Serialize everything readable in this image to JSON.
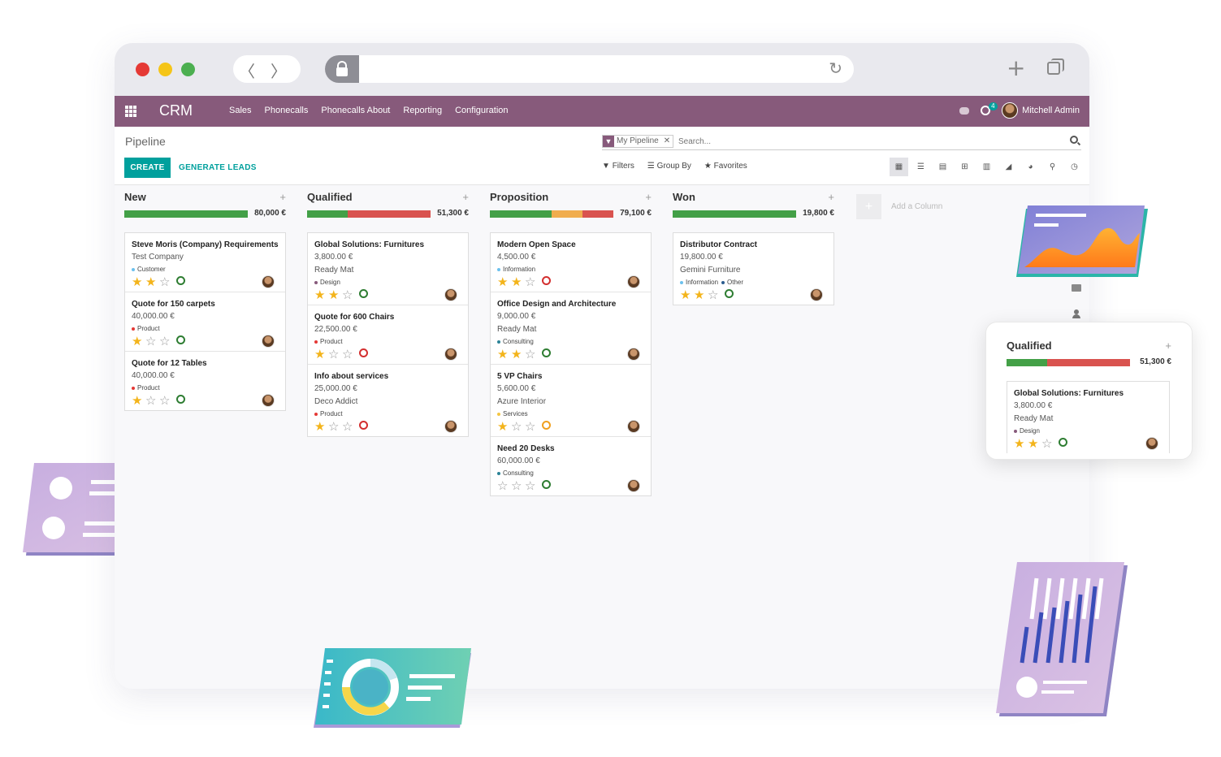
{
  "browser": {
    "back_glyph": "〈",
    "forward_glyph": "〉",
    "reload_glyph": "↻",
    "new_tab_glyph": "+",
    "dots": [
      "#e53935",
      "#f5c518",
      "#4caf50"
    ]
  },
  "topbar": {
    "brand": "CRM",
    "menu": [
      "Sales",
      "Phonecalls",
      "Phonecalls About",
      "Reporting",
      "Configuration"
    ],
    "activity_count": "4",
    "user_name": "Mitchell Admin",
    "color": "#875a7b"
  },
  "control_panel": {
    "breadcrumb": "Pipeline",
    "create_label": "CREATE",
    "generate_label": "GENERATE LEADS",
    "facet_label": "My Pipeline",
    "facet_remove": "✕",
    "search_placeholder": "Search...",
    "filters_label": "Filters",
    "group_by_label": "Group By",
    "favorites_label": "Favorites",
    "views": [
      "kanban-icon",
      "list-icon",
      "calendar-icon",
      "pivot-icon",
      "graph-icon",
      "cohort-icon",
      "dashboard-icon",
      "map-icon",
      "activity-icon"
    ]
  },
  "kanban": {
    "add_column_label": "Add a Column",
    "columns": [
      {
        "name": "New",
        "total": "80,000 €",
        "progress": [
          {
            "color": "#43a047",
            "frac": 1.0
          }
        ],
        "cards": [
          {
            "title": "Steve Moris (Company) Requirements",
            "amount": "",
            "company": "Test Company",
            "tags": [
              {
                "label": "Customer",
                "color": "#6cc1ed"
              }
            ],
            "stars": 2,
            "clock": "#2e7d32"
          },
          {
            "title": "Quote for 150 carpets",
            "amount": "40,000.00 €",
            "company": "",
            "tags": [
              {
                "label": "Product",
                "color": "#e53935"
              }
            ],
            "stars": 1,
            "clock": "#2e7d32"
          },
          {
            "title": "Quote for 12 Tables",
            "amount": "40,000.00 €",
            "company": "",
            "tags": [
              {
                "label": "Product",
                "color": "#e53935"
              }
            ],
            "stars": 1,
            "clock": "#2e7d32"
          }
        ]
      },
      {
        "name": "Qualified",
        "total": "51,300 €",
        "progress": [
          {
            "color": "#43a047",
            "frac": 0.33
          },
          {
            "color": "#d9534f",
            "frac": 0.67
          }
        ],
        "cards": [
          {
            "title": "Global Solutions: Furnitures",
            "amount": "3,800.00 €",
            "company": "Ready Mat",
            "tags": [
              {
                "label": "Design",
                "color": "#875a7b"
              }
            ],
            "stars": 2,
            "clock": "#2e7d32"
          },
          {
            "title": "Quote for 600 Chairs",
            "amount": "22,500.00 €",
            "company": "",
            "tags": [
              {
                "label": "Product",
                "color": "#e53935"
              }
            ],
            "stars": 1,
            "clock": "#d32f2f"
          },
          {
            "title": "Info about services",
            "amount": "25,000.00 €",
            "company": "Deco Addict",
            "tags": [
              {
                "label": "Product",
                "color": "#e53935"
              }
            ],
            "stars": 1,
            "clock": "#d32f2f"
          }
        ]
      },
      {
        "name": "Proposition",
        "total": "79,100 €",
        "progress": [
          {
            "color": "#43a047",
            "frac": 0.5
          },
          {
            "color": "#f0ad4e",
            "frac": 0.25
          },
          {
            "color": "#d9534f",
            "frac": 0.25
          }
        ],
        "cards": [
          {
            "title": "Modern Open Space",
            "amount": "4,500.00 €",
            "company": "",
            "tags": [
              {
                "label": "Information",
                "color": "#6cc1ed"
              }
            ],
            "stars": 2,
            "clock": "#d32f2f"
          },
          {
            "title": "Office Design and Architecture",
            "amount": "9,000.00 €",
            "company": "Ready Mat",
            "tags": [
              {
                "label": "Consulting",
                "color": "#2c8397"
              }
            ],
            "stars": 2,
            "clock": "#2e7d32"
          },
          {
            "title": "5 VP Chairs",
            "amount": "5,600.00 €",
            "company": "Azure Interior",
            "tags": [
              {
                "label": "Services",
                "color": "#f4c542"
              }
            ],
            "stars": 1,
            "clock": "#f0a020"
          },
          {
            "title": "Need 20 Desks",
            "amount": "60,000.00 €",
            "company": "",
            "tags": [
              {
                "label": "Consulting",
                "color": "#2c8397"
              }
            ],
            "stars": 0,
            "clock": "#2e7d32"
          }
        ]
      },
      {
        "name": "Won",
        "total": "19,800 €",
        "progress": [
          {
            "color": "#43a047",
            "frac": 1.0
          }
        ],
        "cards": [
          {
            "title": "Distributor Contract",
            "amount": "19,800.00 €",
            "company": "Gemini Furniture",
            "tags": [
              {
                "label": "Information",
                "color": "#6cc1ed"
              },
              {
                "label": "Other",
                "color": "#2c5d8f"
              }
            ],
            "stars": 2,
            "clock": "#2e7d32"
          }
        ]
      }
    ]
  },
  "floating_qualified": {
    "name": "Qualified",
    "total": "51,300 €",
    "progress": [
      {
        "color": "#43a047",
        "frac": 0.33
      },
      {
        "color": "#d9534f",
        "frac": 0.67
      }
    ],
    "card": {
      "title": "Global Solutions: Furnitures",
      "amount": "3,800.00 €",
      "company": "Ready Mat",
      "tags": [
        {
          "label": "Design",
          "color": "#875a7b"
        }
      ],
      "stars": 2,
      "clock": "#2e7d32"
    }
  },
  "plus_glyph": "+"
}
